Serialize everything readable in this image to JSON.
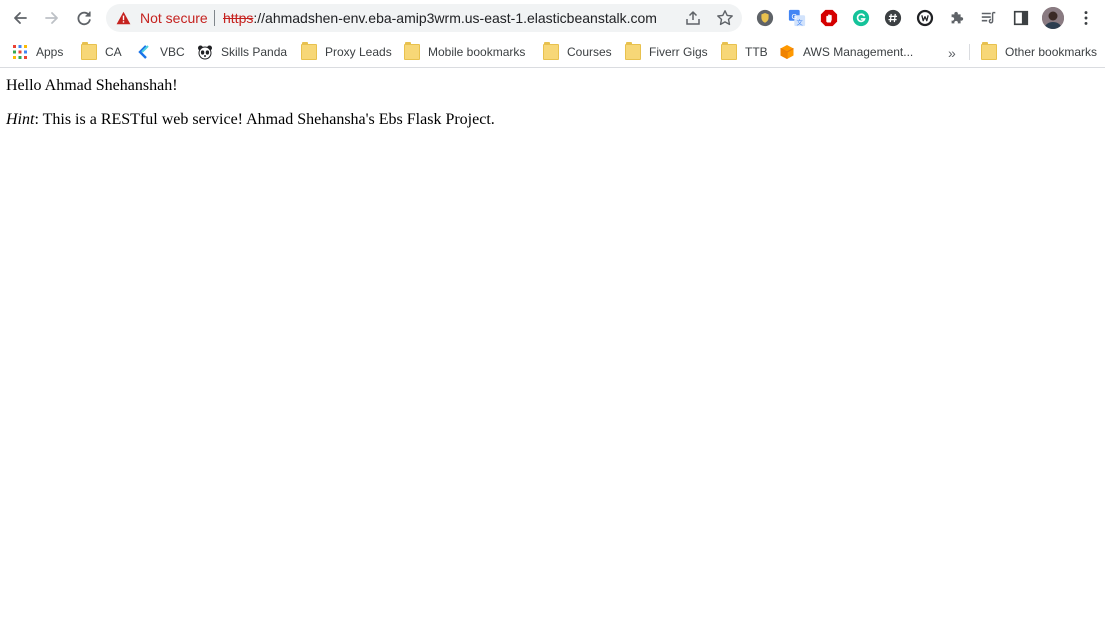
{
  "browser": {
    "security_label": "Not secure",
    "url_scheme": "https",
    "url_rest": "://ahmadshen-env.eba-amip3wrm.us-east-1.elasticbeanstalk.com",
    "accent_warning": "#c5221f"
  },
  "toolbar": {
    "icons": [
      "back-arrow-icon",
      "forward-arrow-icon",
      "reload-icon",
      "share-icon",
      "star-icon",
      "puzzle-extensions-icon",
      "reading-list-icon",
      "side-panel-icon",
      "kebab-menu-icon"
    ],
    "extension_icons": [
      "shield-extension-icon",
      "google-translate-icon",
      "adblock-icon",
      "grammarly-icon",
      "hash-extension-icon",
      "wappalyzer-icon"
    ]
  },
  "bookmarks": {
    "items": [
      {
        "label": "Apps",
        "icon": "apps-grid-icon"
      },
      {
        "label": "CA",
        "icon": "folder-icon"
      },
      {
        "label": "VBC",
        "icon": "vbc-icon"
      },
      {
        "label": "Skills Panda",
        "icon": "panda-icon"
      },
      {
        "label": "Proxy Leads",
        "icon": "folder-icon"
      },
      {
        "label": "Mobile bookmarks",
        "icon": "folder-icon"
      },
      {
        "label": "Courses",
        "icon": "folder-icon"
      },
      {
        "label": "Fiverr Gigs",
        "icon": "folder-icon"
      },
      {
        "label": "TTB",
        "icon": "folder-icon"
      },
      {
        "label": "AWS Management...",
        "icon": "aws-cube-icon"
      }
    ],
    "overflow": "»",
    "other": "Other bookmarks"
  },
  "page": {
    "greeting": "Hello Ahmad Shehanshah!",
    "hint_label": "Hint",
    "hint_text": ": This is a RESTful web service! Ahmad Shehansha's Ebs Flask Project."
  }
}
